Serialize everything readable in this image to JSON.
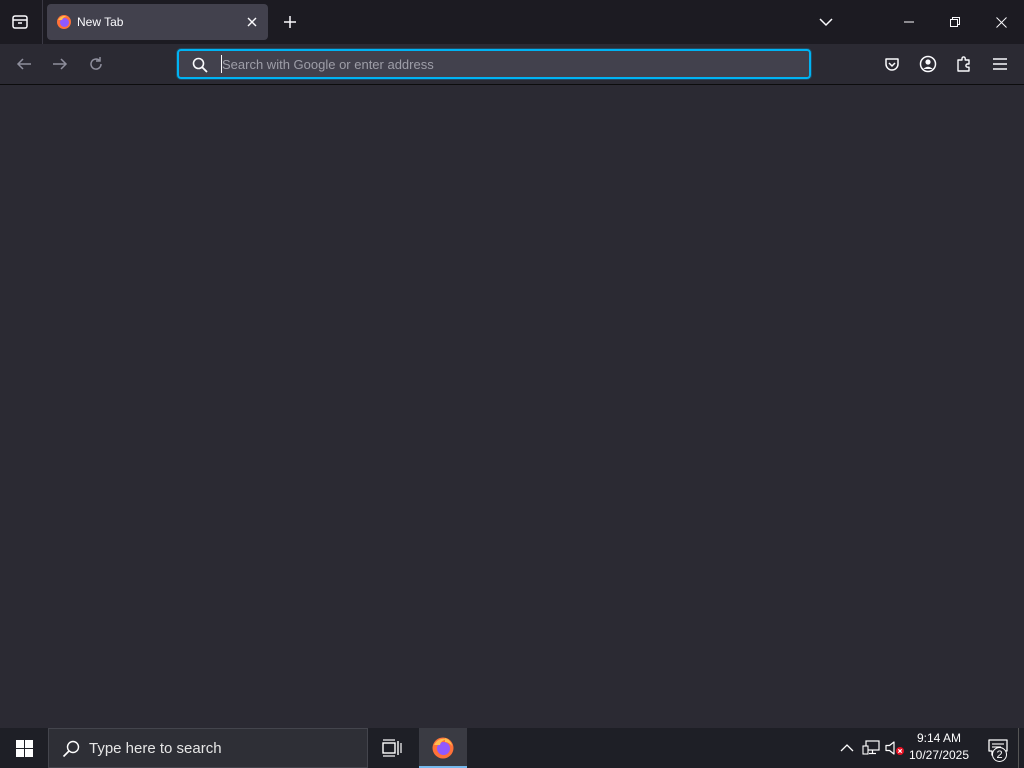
{
  "browser": {
    "tab": {
      "title": "New Tab"
    },
    "urlbar": {
      "placeholder": "Search with Google or enter address",
      "value": ""
    },
    "colors": {
      "accent": "#00b3f4",
      "chrome_bg": "#1c1b22",
      "toolbar_bg": "#2b2a33",
      "tab_bg": "#42414d"
    },
    "icons": {
      "tab_list": "firefox-view-icon",
      "new_tab": "plus-icon",
      "all_tabs": "chevron-down-icon",
      "back": "back-arrow-icon",
      "forward": "forward-arrow-icon",
      "reload": "reload-icon",
      "pocket": "pocket-icon",
      "account": "account-icon",
      "extensions": "puzzle-piece-icon",
      "menu": "hamburger-menu-icon"
    }
  },
  "taskbar": {
    "search_placeholder": "Type here to search",
    "clock": {
      "time": "9:14 AM",
      "date": "10/27/2025"
    },
    "notifications_count": "2",
    "active_app": "Firefox",
    "accent": "#76b9ed"
  }
}
